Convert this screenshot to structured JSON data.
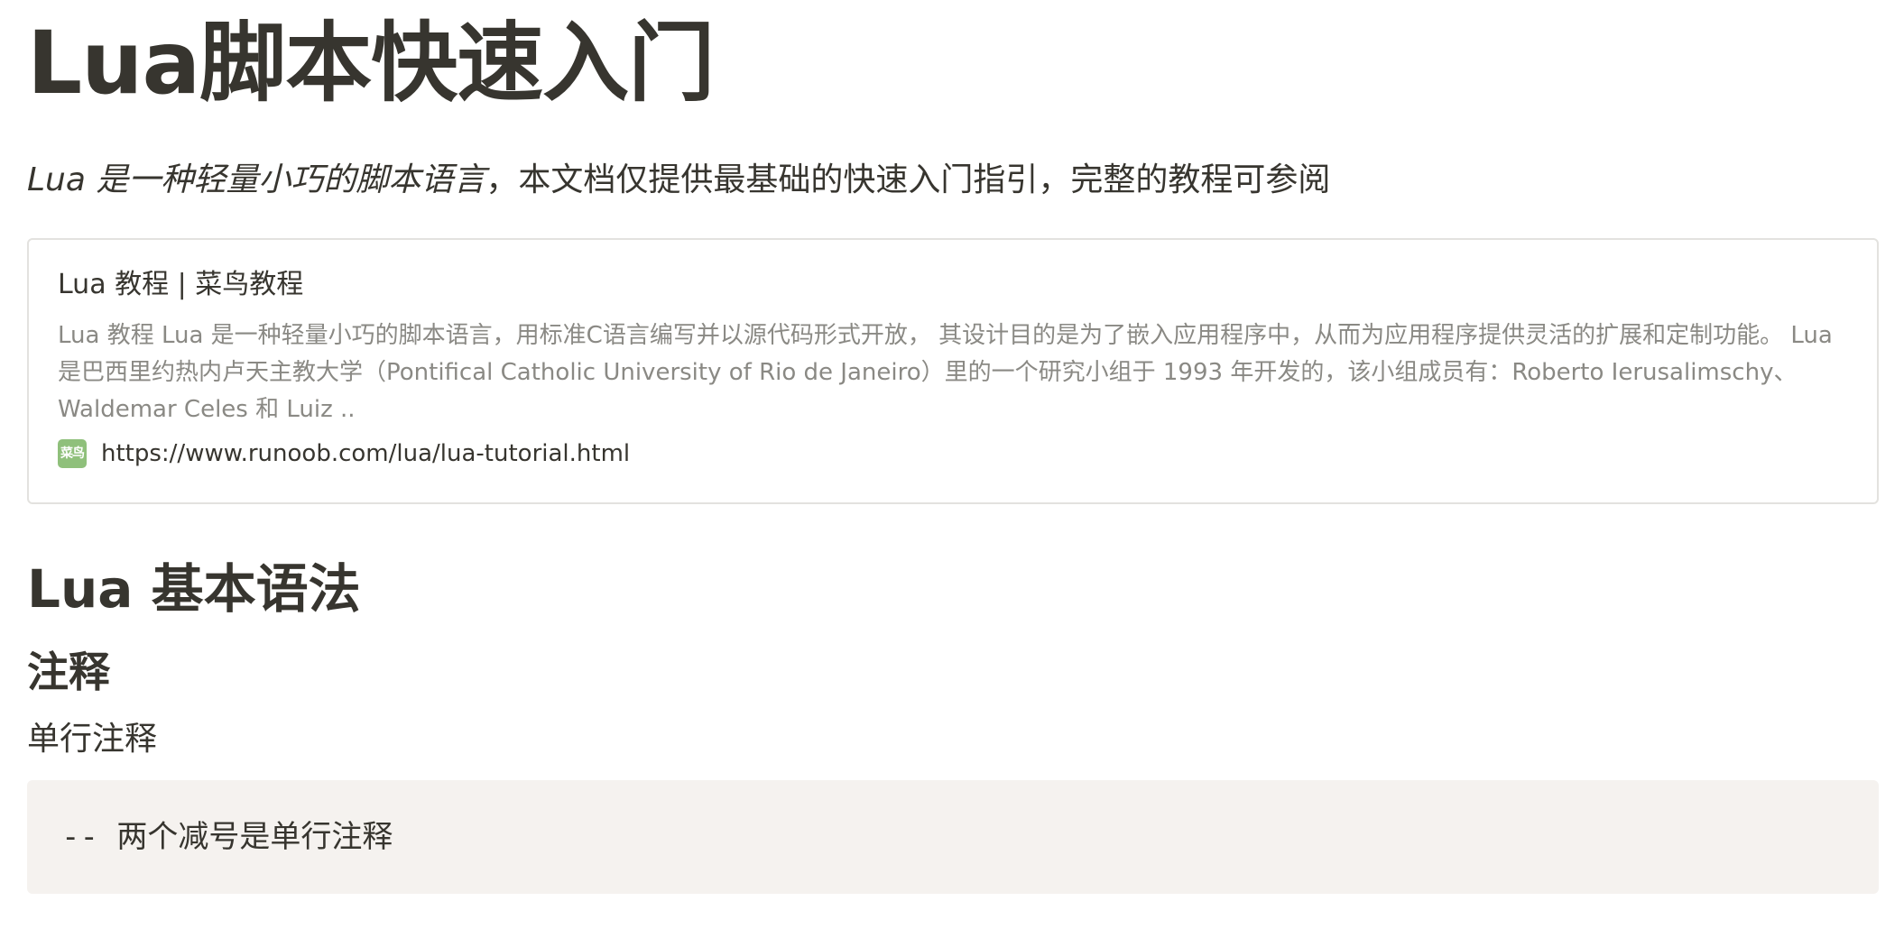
{
  "page": {
    "title": "Lua脚本快速入门",
    "intro_italic": "Lua 是一种轻量小巧的脚本语言",
    "intro_rest": "，本文档仅提供最基础的快速入门指引，完整的教程可参阅"
  },
  "bookmark": {
    "title": "Lua 教程 | 菜鸟教程",
    "description": "Lua 教程   Lua 是一种轻量小巧的脚本语言，用标准C语言编写并以源代码形式开放， 其设计目的是为了嵌入应用程序中，从而为应用程序提供灵活的扩展和定制功能。 Lua 是巴西里约热内卢天主教大学（Pontifical Catholic University of Rio de Janeiro）里的一个研究小组于 1993 年开发的，该小组成员有：Roberto Ierusalimschy、Waldemar Celes 和 Luiz ..",
    "favicon_text": "菜鸟",
    "favicon_icon": "runoob-favicon-icon",
    "url": "https://www.runoob.com/lua/lua-tutorial.html",
    "favicon_color": "#8fc07b"
  },
  "sections": {
    "heading": "Lua 基本语法",
    "subheading": "注释",
    "paragraph": "单行注释"
  },
  "code": {
    "text": "-- 两个减号是单行注释"
  },
  "colors": {
    "text": "#37352f",
    "muted": "#8a8984",
    "code_bg": "#f5f2ef",
    "border": "#e3e2df"
  }
}
